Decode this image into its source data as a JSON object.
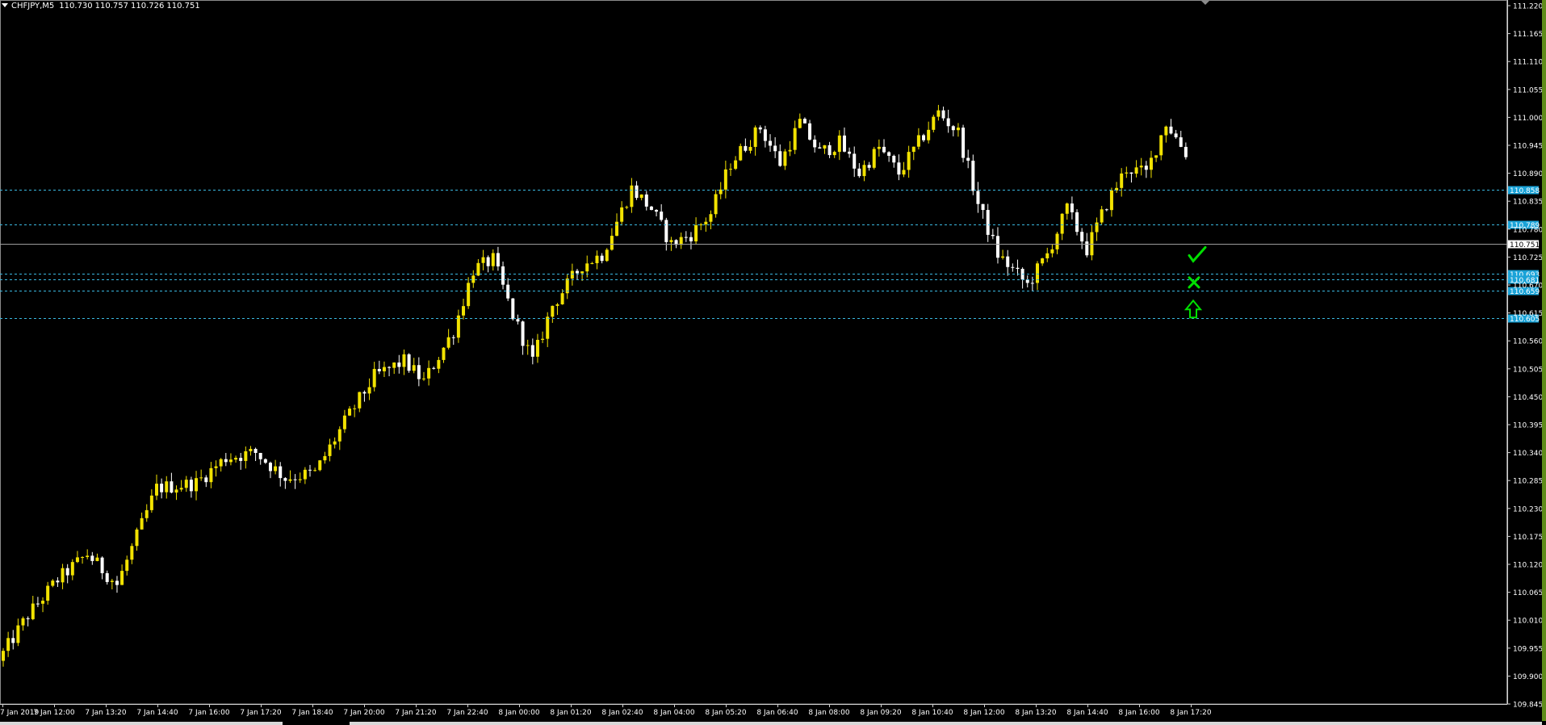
{
  "window": {
    "symbol": "CHFJPY,M5",
    "quotes": [
      "110.730",
      "110.757",
      "110.726",
      "110.751"
    ]
  },
  "colors": {
    "background": "#000000",
    "bull_candle": "#f2e200",
    "bear_candle": "#ffffff",
    "grid_text": "#ffffff",
    "level_line": "#3ab8e0",
    "level_label_bg": "#1aa3d8",
    "price_line": "#9a9a9a",
    "signal_green": "#00e000"
  },
  "icons": [
    "menu-triangle-icon",
    "check-mark-icon",
    "cross-mark-icon",
    "buy-arrow-icon",
    "chart-shift-marker-icon"
  ],
  "chart_data": {
    "type": "candlestick",
    "symbol": "CHFJPY",
    "timeframe": "M5",
    "ylim": [
      109.845,
      111.22
    ],
    "y_ticks": [
      "111.220",
      "111.165",
      "111.110",
      "111.055",
      "111.000",
      "110.945",
      "110.890",
      "110.835",
      "110.780",
      "110.725",
      "110.670",
      "110.615",
      "110.560",
      "110.505",
      "110.450",
      "110.395",
      "110.340",
      "110.285",
      "110.230",
      "110.175",
      "110.120",
      "110.065",
      "110.010",
      "109.955",
      "109.900",
      "109.845"
    ],
    "x_ticks": [
      "7 Jan 2019",
      "7 Jan 12:00",
      "7 Jan 13:20",
      "7 Jan 14:40",
      "7 Jan 16:00",
      "7 Jan 17:20",
      "7 Jan 18:40",
      "7 Jan 20:00",
      "7 Jan 21:20",
      "7 Jan 22:40",
      "8 Jan 00:00",
      "8 Jan 01:20",
      "8 Jan 02:40",
      "8 Jan 04:00",
      "8 Jan 05:20",
      "8 Jan 06:40",
      "8 Jan 08:00",
      "8 Jan 09:20",
      "8 Jan 10:40",
      "8 Jan 12:00",
      "8 Jan 13:20",
      "8 Jan 14:40",
      "8 Jan 16:00",
      "8 Jan 17:20"
    ],
    "candle_count": 240,
    "close_path": [
      [
        0,
        109.93
      ],
      [
        6,
        110.02
      ],
      [
        12,
        110.09
      ],
      [
        18,
        110.14
      ],
      [
        24,
        110.08
      ],
      [
        32,
        110.27
      ],
      [
        40,
        110.28
      ],
      [
        46,
        110.33
      ],
      [
        52,
        110.34
      ],
      [
        58,
        110.29
      ],
      [
        64,
        110.3
      ],
      [
        70,
        110.4
      ],
      [
        76,
        110.49
      ],
      [
        82,
        110.52
      ],
      [
        86,
        110.48
      ],
      [
        92,
        110.58
      ],
      [
        96,
        110.7
      ],
      [
        100,
        110.72
      ],
      [
        104,
        110.61
      ],
      [
        108,
        110.52
      ],
      [
        112,
        110.63
      ],
      [
        118,
        110.71
      ],
      [
        122,
        110.73
      ],
      [
        128,
        110.86
      ],
      [
        132,
        110.82
      ],
      [
        136,
        110.75
      ],
      [
        140,
        110.77
      ],
      [
        144,
        110.81
      ],
      [
        148,
        110.91
      ],
      [
        154,
        110.98
      ],
      [
        158,
        110.91
      ],
      [
        162,
        110.99
      ],
      [
        166,
        110.93
      ],
      [
        170,
        110.95
      ],
      [
        174,
        110.89
      ],
      [
        178,
        110.94
      ],
      [
        182,
        110.89
      ],
      [
        186,
        110.95
      ],
      [
        190,
        111.01
      ],
      [
        194,
        110.97
      ],
      [
        198,
        110.83
      ],
      [
        202,
        110.73
      ],
      [
        208,
        110.67
      ],
      [
        212,
        110.73
      ],
      [
        216,
        110.82
      ],
      [
        220,
        110.74
      ],
      [
        224,
        110.83
      ],
      [
        228,
        110.9
      ],
      [
        232,
        110.89
      ],
      [
        236,
        110.99
      ],
      [
        240,
        110.93
      ]
    ],
    "levels": [
      {
        "price": "110.858",
        "style": "dashed"
      },
      {
        "price": "110.789",
        "style": "dashed"
      },
      {
        "price": "110.751",
        "style": "solid",
        "current": true
      },
      {
        "price": "110.693",
        "style": "dashed"
      },
      {
        "price": "110.681",
        "style": "dashed"
      },
      {
        "price": "110.659",
        "style": "dashed"
      },
      {
        "price": "110.605",
        "style": "dashed"
      }
    ],
    "signals": [
      {
        "type": "check",
        "price": 110.725
      },
      {
        "type": "cross",
        "price": 110.675
      },
      {
        "type": "buy-arrow",
        "price": 110.625
      }
    ]
  }
}
